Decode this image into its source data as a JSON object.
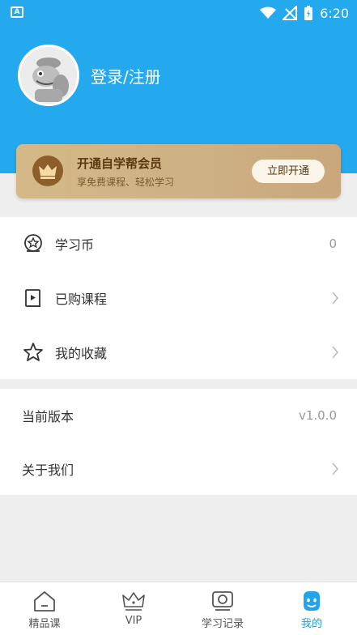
{
  "status_bar": {
    "time": "6:20",
    "app_icon_letter": "A"
  },
  "profile": {
    "login_label": "登录/注册"
  },
  "vip_card": {
    "title": "开通自学帮会员",
    "subtitle": "享免费课程、轻松学习",
    "button_label": "立即开通"
  },
  "menu_section_1": {
    "items": [
      {
        "label": "学习币",
        "value": "0",
        "icon": "coin-icon"
      },
      {
        "label": "已购课程",
        "icon": "book-icon"
      },
      {
        "label": "我的收藏",
        "icon": "star-icon"
      }
    ]
  },
  "menu_section_2": {
    "items": [
      {
        "label": "当前版本",
        "value": "v1.0.0"
      },
      {
        "label": "关于我们"
      }
    ]
  },
  "tabbar": {
    "tabs": [
      {
        "label": "精品课",
        "icon": "home-icon"
      },
      {
        "label": "VIP",
        "icon": "crown-icon"
      },
      {
        "label": "学习记录",
        "icon": "record-icon"
      },
      {
        "label": "我的",
        "icon": "smile-icon"
      }
    ],
    "active_index": 3
  },
  "colors": {
    "primary": "#24a8ee",
    "active_tab": "#1f9fe8",
    "vip_gold": "#d4b988"
  }
}
